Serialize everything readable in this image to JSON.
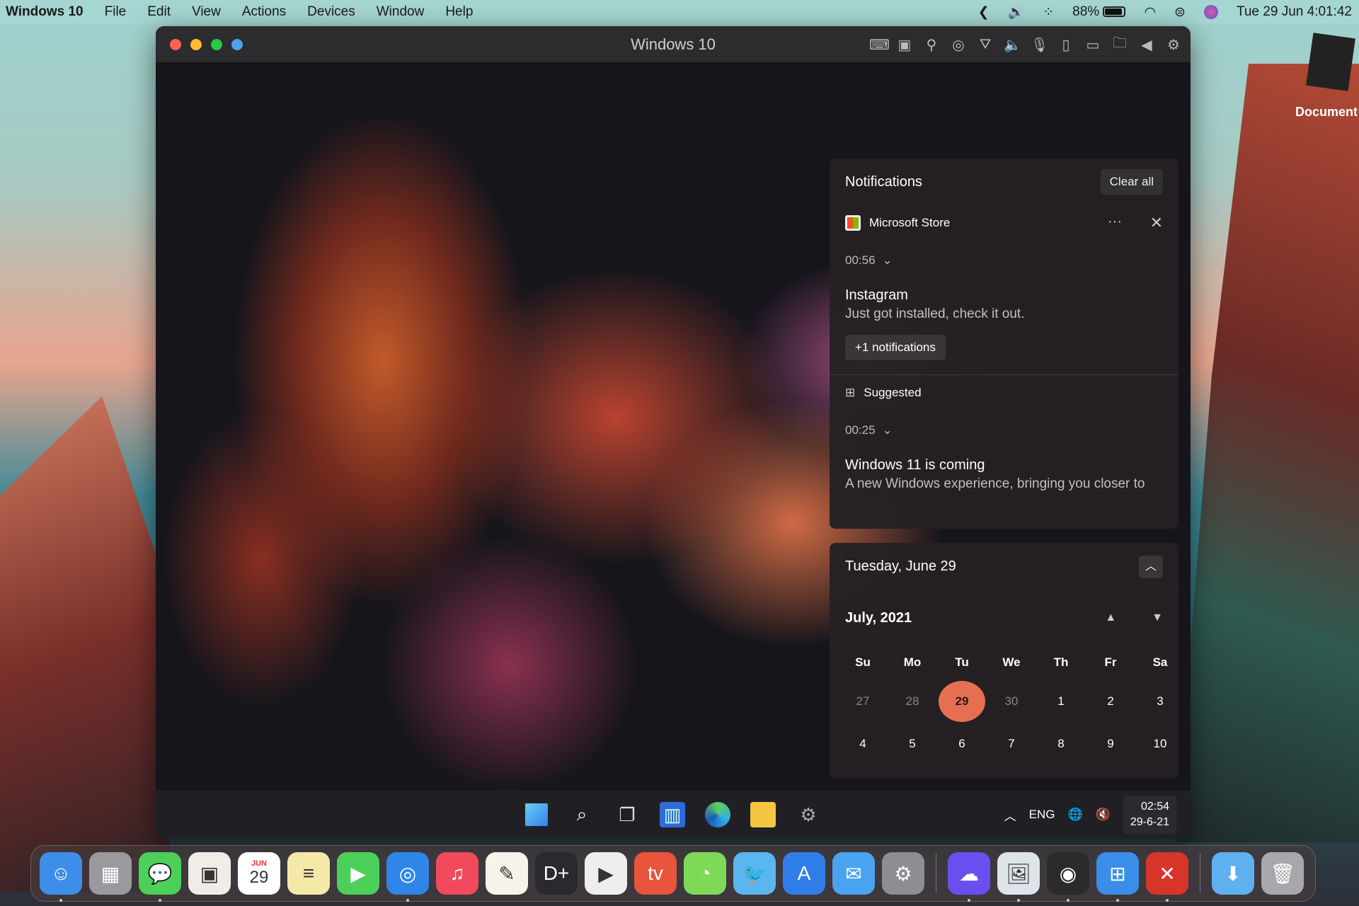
{
  "menubar": {
    "app": "Windows 10",
    "items": [
      "File",
      "Edit",
      "View",
      "Actions",
      "Devices",
      "Window",
      "Help"
    ],
    "battery": "88%",
    "datetime": "Tue 29 Jun  4:01:42"
  },
  "desktop": {
    "document_label": "Document"
  },
  "vm": {
    "title": "Windows 10"
  },
  "notifications": {
    "title": "Notifications",
    "clear_all": "Clear all",
    "groups": [
      {
        "app": "Microsoft Store",
        "time": "00:56",
        "title": "Instagram",
        "body": "Just got installed, check it out.",
        "more": "+1 notifications"
      },
      {
        "app": "Suggested",
        "time": "00:25",
        "title": "Windows 11 is coming",
        "body": "A new Windows experience, bringing you closer to"
      }
    ]
  },
  "calendar": {
    "date_header": "Tuesday, June 29",
    "month": "July, 2021",
    "weekdays": [
      "Su",
      "Mo",
      "Tu",
      "We",
      "Th",
      "Fr",
      "Sa"
    ],
    "days": [
      {
        "d": "27",
        "dim": true
      },
      {
        "d": "28",
        "dim": true
      },
      {
        "d": "29",
        "today": true
      },
      {
        "d": "30",
        "dim": true
      },
      {
        "d": "1"
      },
      {
        "d": "2"
      },
      {
        "d": "3"
      },
      {
        "d": "4"
      },
      {
        "d": "5"
      },
      {
        "d": "6"
      },
      {
        "d": "7"
      },
      {
        "d": "8"
      },
      {
        "d": "9"
      },
      {
        "d": "10"
      }
    ],
    "accent": "#e76f51"
  },
  "taskbar": {
    "lang": "ENG",
    "time": "02:54",
    "date": "29-6-21"
  },
  "dock": {
    "apps": [
      {
        "name": "finder",
        "color": "#3d8ee8",
        "glyph": "☺",
        "dot": true
      },
      {
        "name": "launchpad",
        "color": "#9a9a9e",
        "glyph": "▦"
      },
      {
        "name": "messages",
        "color": "#4cd05a",
        "glyph": "💬",
        "dot": true
      },
      {
        "name": "photo-app",
        "color": "#f0ece8",
        "glyph": "▣"
      },
      {
        "name": "calendar",
        "color": "#ffffff",
        "glyph": "29",
        "label": "JUN"
      },
      {
        "name": "notes",
        "color": "#f5e9a8",
        "glyph": "≡"
      },
      {
        "name": "facetime",
        "color": "#4cd05a",
        "glyph": "▶"
      },
      {
        "name": "safari",
        "color": "#2f86e8",
        "glyph": "◎",
        "dot": true
      },
      {
        "name": "music",
        "color": "#f04a5c",
        "glyph": "♫"
      },
      {
        "name": "pages",
        "color": "#f7f3ea",
        "glyph": "✎"
      },
      {
        "name": "disney-plus",
        "color": "#2a2a2e",
        "glyph": "D+"
      },
      {
        "name": "video-player",
        "color": "#eeeeee",
        "glyph": "▶"
      },
      {
        "name": "tv",
        "color": "#e8553a",
        "glyph": "tv"
      },
      {
        "name": "green-app",
        "color": "#7ed957",
        "glyph": "◔"
      },
      {
        "name": "twitter",
        "color": "#5bb6f0",
        "glyph": "🐦"
      },
      {
        "name": "app-store",
        "color": "#2f7ee8",
        "glyph": "A"
      },
      {
        "name": "mail",
        "color": "#4aa3f0",
        "glyph": "✉"
      },
      {
        "name": "system-preferences",
        "color": "#8e8e92",
        "glyph": "⚙"
      },
      {
        "sep": true
      },
      {
        "name": "proxy-app",
        "color": "#6a4ef0",
        "glyph": "☁",
        "dot": true
      },
      {
        "name": "preview",
        "color": "#dde4ea",
        "glyph": "🖼",
        "dot": true
      },
      {
        "name": "steam",
        "color": "#2b2b2e",
        "glyph": "◉",
        "dot": true
      },
      {
        "name": "parallels-windows",
        "color": "#3a8ee8",
        "glyph": "⊞",
        "dot": true
      },
      {
        "name": "crossover",
        "color": "#d8352a",
        "glyph": "✕",
        "dot": true
      },
      {
        "sep": true
      },
      {
        "name": "downloads",
        "color": "#5fb0ee",
        "glyph": "⬇"
      },
      {
        "name": "trash",
        "color": "#a8a8ac",
        "glyph": "🗑"
      }
    ]
  }
}
